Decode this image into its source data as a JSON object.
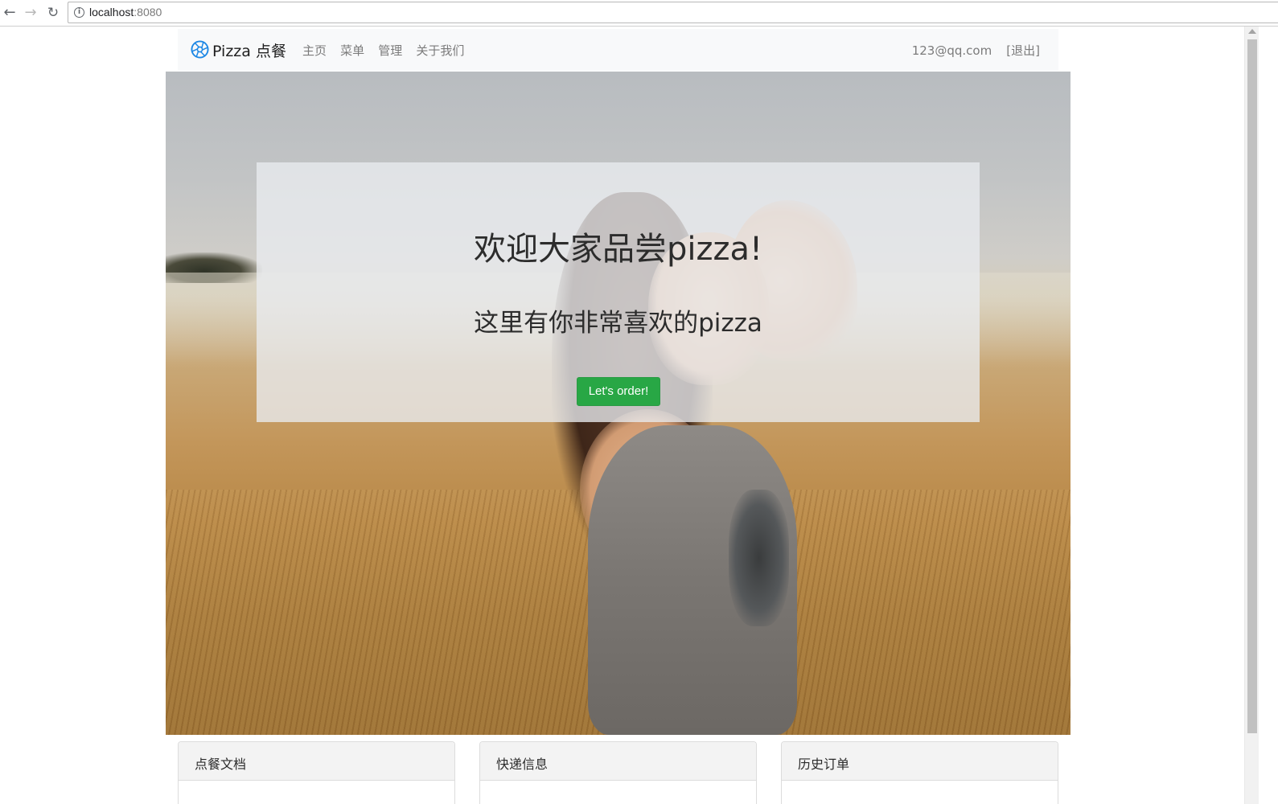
{
  "browser": {
    "url_host": "localhost",
    "url_port": ":8080",
    "icons": {
      "back": "arrow-left-icon",
      "forward": "arrow-right-icon",
      "reload": "reload-icon",
      "info": "info-icon"
    }
  },
  "navbar": {
    "brand": "Pizza 点餐",
    "brand_icon": "aperture-logo-icon",
    "links": [
      "主页",
      "菜单",
      "管理",
      "关于我们"
    ],
    "user_email": "123@qq.com",
    "logout_label": "[退出]"
  },
  "hero": {
    "title": "欢迎大家品尝pizza!",
    "subtitle": "这里有你非常喜欢的pizza",
    "button_label": "Let's order!"
  },
  "cards": [
    {
      "header": "点餐文档"
    },
    {
      "header": "快递信息"
    },
    {
      "header": "历史订单"
    }
  ],
  "colors": {
    "brand_icon": "#1e88e5",
    "button": "#28a745",
    "navbar_bg": "#f8f9fa",
    "jumbotron_bg": "#e9ecef"
  }
}
